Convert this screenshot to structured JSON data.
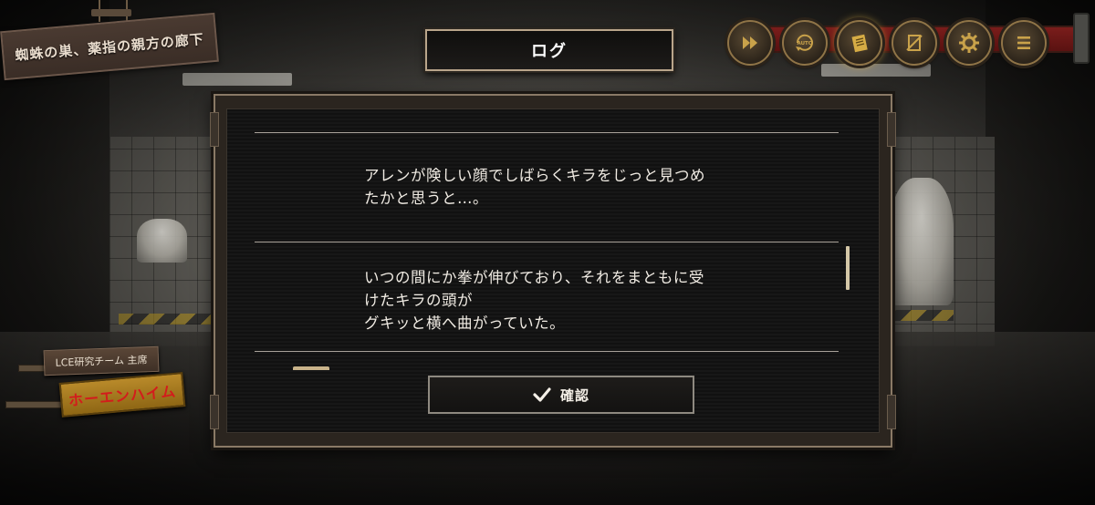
{
  "location": "蜘蛛の巣、薬指の親方の廊下",
  "toolbar": {
    "buttons": [
      {
        "name": "fast-forward",
        "icon": "fast-forward-icon"
      },
      {
        "name": "auto",
        "icon": "auto-icon",
        "label": "AUTO"
      },
      {
        "name": "log",
        "icon": "log-book-icon",
        "active": true
      },
      {
        "name": "hide-ui",
        "icon": "hide-icon"
      },
      {
        "name": "settings",
        "icon": "gear-icon"
      },
      {
        "name": "menu",
        "icon": "menu-icon"
      }
    ]
  },
  "dialog": {
    "title": "ログ",
    "entries": [
      {
        "lines": [
          "アレンが険しい顔でしばらくキラをじっと見つめ",
          "たかと思うと…。"
        ]
      },
      {
        "lines": [
          "いつの間にか拳が伸びており、それをまともに受",
          "けたキラの頭が",
          "グキッと横へ曲がっていた。"
        ]
      }
    ],
    "confirm_label": "確認",
    "confirm_icon": "check-icon"
  },
  "speaker": {
    "affiliation": "LCE研究チーム 主席",
    "name": "ホーエンハイム"
  },
  "colors": {
    "accent_gold": "#d6ac45",
    "rail_red": "#7a1d1b",
    "name_red": "#d31c1c"
  }
}
